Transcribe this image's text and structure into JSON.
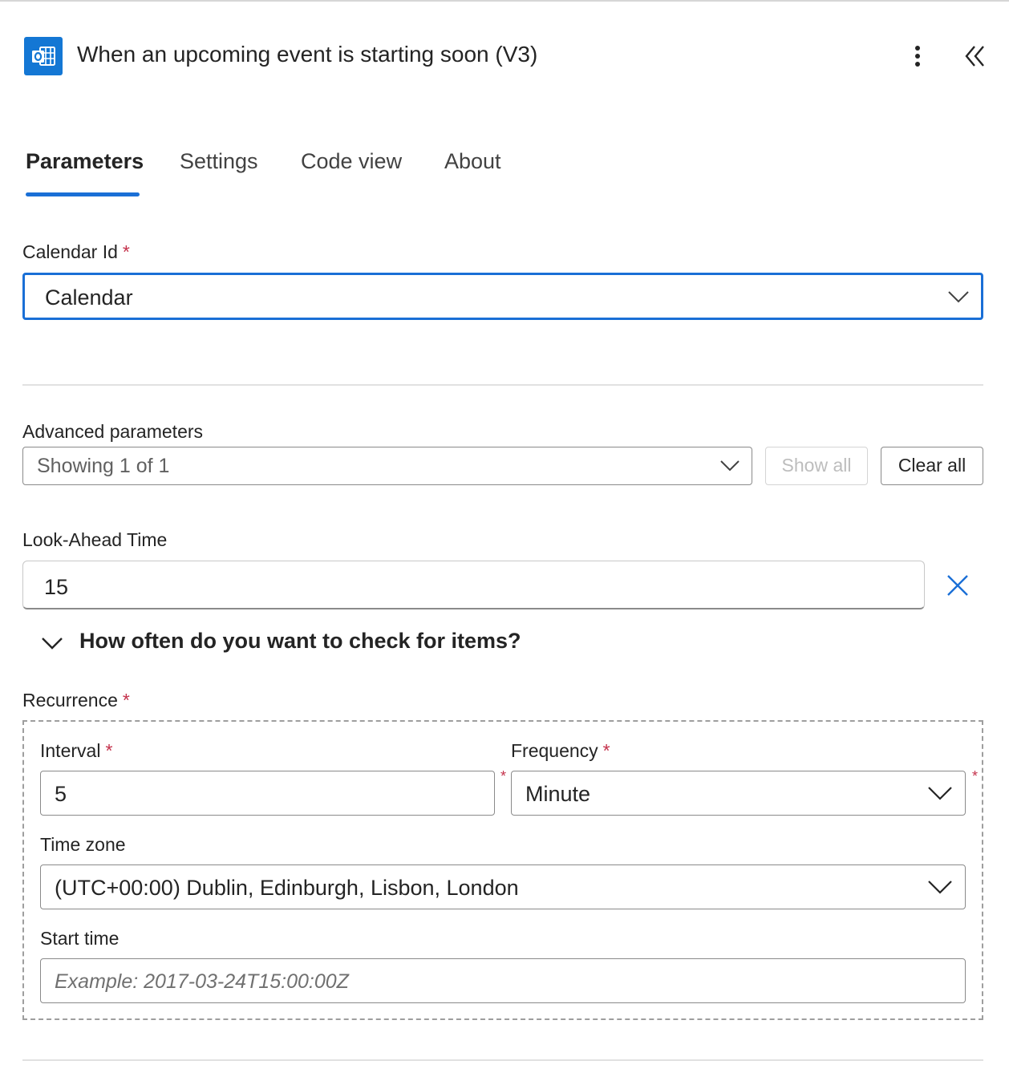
{
  "header": {
    "title": "When an upcoming event is starting soon (V3)",
    "app_icon": "outlook-calendar-icon",
    "more_icon": "more-vertical-icon",
    "collapse_icon": "double-chevron-left-icon",
    "accent_color": "#1477d4"
  },
  "tabs": [
    {
      "label": "Parameters",
      "active": true
    },
    {
      "label": "Settings",
      "active": false
    },
    {
      "label": "Code view",
      "active": false
    },
    {
      "label": "About",
      "active": false
    }
  ],
  "calendar_id": {
    "label": "Calendar Id",
    "required_mark": "*",
    "value": "Calendar"
  },
  "advanced": {
    "label": "Advanced parameters",
    "select_value": "Showing 1 of 1",
    "show_all_label": "Show all",
    "clear_all_label": "Clear all"
  },
  "look_ahead": {
    "label": "Look-Ahead Time",
    "value": "15"
  },
  "section_toggle": {
    "label": "How often do you want to check for items?"
  },
  "recurrence": {
    "label": "Recurrence",
    "required_mark": "*",
    "interval": {
      "label": "Interval",
      "required_mark": "*",
      "value": "5"
    },
    "frequency": {
      "label": "Frequency",
      "required_mark": "*",
      "value": "Minute"
    },
    "time_zone": {
      "label": "Time zone",
      "value": "(UTC+00:00) Dublin, Edinburgh, Lisbon, London"
    },
    "start_time": {
      "label": "Start time",
      "placeholder": "Example: 2017-03-24T15:00:00Z"
    }
  }
}
